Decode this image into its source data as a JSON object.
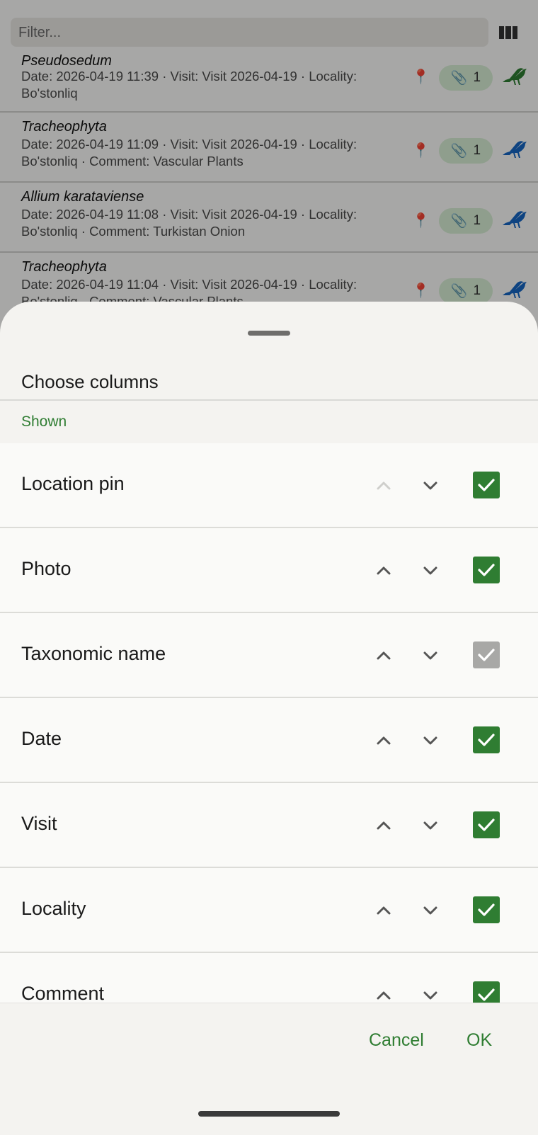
{
  "filter": {
    "placeholder": "Filter..."
  },
  "records": [
    {
      "name": "Pseudosedum",
      "meta": "Date: 2026-04-19 11:39  ·  Visit: Visit 2026-04-19  ·  Locality: Bo'stonliq",
      "attachments": "1",
      "bird_color": "#2e7d32"
    },
    {
      "name": "Tracheophyta",
      "meta": "Date: 2026-04-19 11:09  ·  Visit: Visit 2026-04-19  ·  Locality: Bo'stonliq  ·  Comment: Vascular Plants",
      "attachments": "1",
      "bird_color": "#1565c0"
    },
    {
      "name": "Allium karataviense",
      "meta": "Date: 2026-04-19 11:08  ·  Visit: Visit 2026-04-19  ·  Locality: Bo'stonliq  ·  Comment: Turkistan Onion",
      "attachments": "1",
      "bird_color": "#1565c0"
    },
    {
      "name": "Tracheophyta",
      "meta": "Date: 2026-04-19 11:04  ·  Visit: Visit 2026-04-19  ·  Locality: Bo'stonliq  ·  Comment: Vascular Plants",
      "attachments": "1",
      "bird_color": "#1565c0"
    }
  ],
  "sheet": {
    "title": "Choose columns",
    "section": "Shown",
    "columns": [
      {
        "label": "Location pin",
        "checked": true,
        "up_enabled": false,
        "check_enabled": true
      },
      {
        "label": "Photo",
        "checked": true,
        "up_enabled": true,
        "check_enabled": true
      },
      {
        "label": "Taxonomic name",
        "checked": true,
        "up_enabled": true,
        "check_enabled": false
      },
      {
        "label": "Date",
        "checked": true,
        "up_enabled": true,
        "check_enabled": true
      },
      {
        "label": "Visit",
        "checked": true,
        "up_enabled": true,
        "check_enabled": true
      },
      {
        "label": "Locality",
        "checked": true,
        "up_enabled": true,
        "check_enabled": true
      },
      {
        "label": "Comment",
        "checked": true,
        "up_enabled": true,
        "check_enabled": true
      }
    ],
    "cancel_label": "Cancel",
    "ok_label": "OK"
  },
  "colors": {
    "accent": "#2f7d32",
    "disabled": "#a8a8a6"
  }
}
